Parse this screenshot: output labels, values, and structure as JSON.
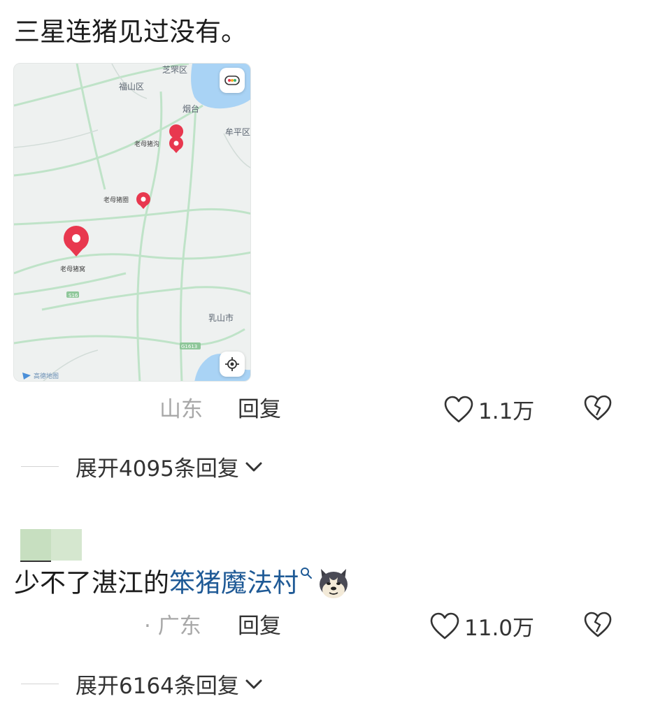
{
  "comments": [
    {
      "text": "三星连猪见过没有。",
      "map": {
        "labels": {
          "zhifu": "芝罘区",
          "fushan": "福山区",
          "yantai": "烟台",
          "muping": "牟平区",
          "pig_valley": "老母猪沟",
          "pig_pen": "老母猪圈",
          "pig_nest": "老母猪窝",
          "rushan": "乳山市",
          "road_s16": "S16",
          "road_g1613": "G1613",
          "watermark": "高德地图"
        }
      },
      "location": "山东",
      "reply_label": "回复",
      "likes": "1.1万",
      "expand_label": "展开4095条回复"
    },
    {
      "text_plain": "少不了湛江的",
      "text_link": "笨猪魔法村",
      "location": "· 广东",
      "reply_label": "回复",
      "likes": "11.0万",
      "expand_label": "展开6164条回复"
    }
  ],
  "icons": {
    "like": "heart-outline-icon",
    "dislike": "broken-heart-icon",
    "expand": "chevron-down-icon",
    "search": "search-icon",
    "map_layers": "traffic-layer-icon",
    "map_locate": "locate-icon",
    "emoji": "husky-dog-emoji"
  },
  "colors": {
    "link": "#1f5a96",
    "map_pin": "#e8384f",
    "map_water": "#a9d3f5",
    "map_road": "#bfe3c8",
    "location_text": "#a8a8a8"
  }
}
